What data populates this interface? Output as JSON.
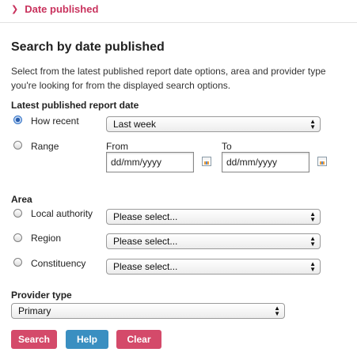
{
  "breadcrumb": {
    "icon": "chevron-right-icon",
    "label": "Date published"
  },
  "heading": "Search by date published",
  "intro": "Select from the latest published report date options, area and provider type you're looking for from the displayed search options.",
  "report_date": {
    "label": "Latest published report date",
    "how_recent": {
      "label": "How recent",
      "value": "Last week",
      "selected": true
    },
    "range": {
      "label": "Range",
      "from_label": "From",
      "to_label": "To",
      "from_value": "dd/mm/yyyy",
      "to_value": "dd/mm/yyyy"
    }
  },
  "area": {
    "label": "Area",
    "options": [
      {
        "label": "Local authority",
        "value": "Please select..."
      },
      {
        "label": "Region",
        "value": "Please select..."
      },
      {
        "label": "Constituency",
        "value": "Please select..."
      }
    ]
  },
  "provider": {
    "label": "Provider type",
    "value": "Primary"
  },
  "buttons": {
    "search": "Search",
    "help": "Help",
    "clear": "Clear"
  },
  "colors": {
    "accent": "#c9335e",
    "help": "#3a8fc1",
    "action": "#d44a6a"
  }
}
